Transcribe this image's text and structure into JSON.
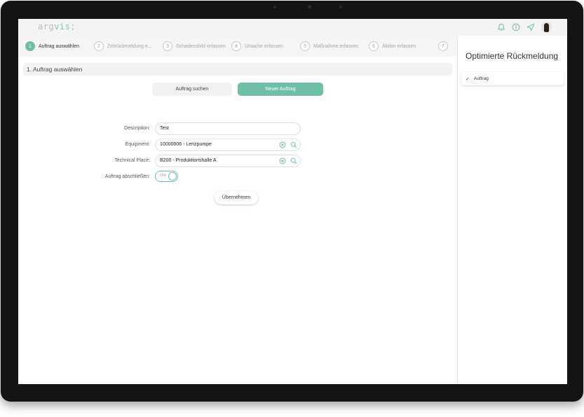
{
  "app": {
    "logo_prefix": "arg",
    "logo_accent": "vis",
    "logo_suffix": ";",
    "accent_color": "#6fbea7"
  },
  "topbar": {
    "icons": [
      "bell-icon",
      "info-icon",
      "send-icon",
      "user-avatar"
    ]
  },
  "steps": [
    {
      "number": "1",
      "label": "Auftrag auswählen",
      "active": true
    },
    {
      "number": "2",
      "label": "Zeitrückmeldung e...",
      "active": false
    },
    {
      "number": "3",
      "label": "Schadensbild erfassen",
      "active": false
    },
    {
      "number": "4",
      "label": "Ursache erfassen",
      "active": false
    },
    {
      "number": "5",
      "label": "Maßnahme erfassen",
      "active": false
    },
    {
      "number": "6",
      "label": "Aktion erfassen",
      "active": false
    },
    {
      "number": "7",
      "label": "",
      "active": false
    }
  ],
  "section": {
    "title": "1. Auftrag auswählen"
  },
  "segmented": {
    "search_label": "Auftrag suchen",
    "new_label": "Neuer Auftrag",
    "selected": "Neuer Auftrag"
  },
  "form": {
    "description": {
      "label": "Description:",
      "value": "Test"
    },
    "equipment": {
      "label": "Equipment:",
      "value": "10000006 - Lenzpumpe"
    },
    "technical_place": {
      "label": "Technical Place:",
      "value": "B200 - Produktionshalle A"
    },
    "close_order": {
      "label": "Auftrag abschließen:",
      "toggle_text": "ON",
      "state": true
    }
  },
  "actions": {
    "apply_label": "Übernehmen"
  },
  "side": {
    "title": "Optimierte Rückmeldung",
    "items": [
      {
        "check": "✓",
        "label": "Auftrag"
      }
    ]
  }
}
